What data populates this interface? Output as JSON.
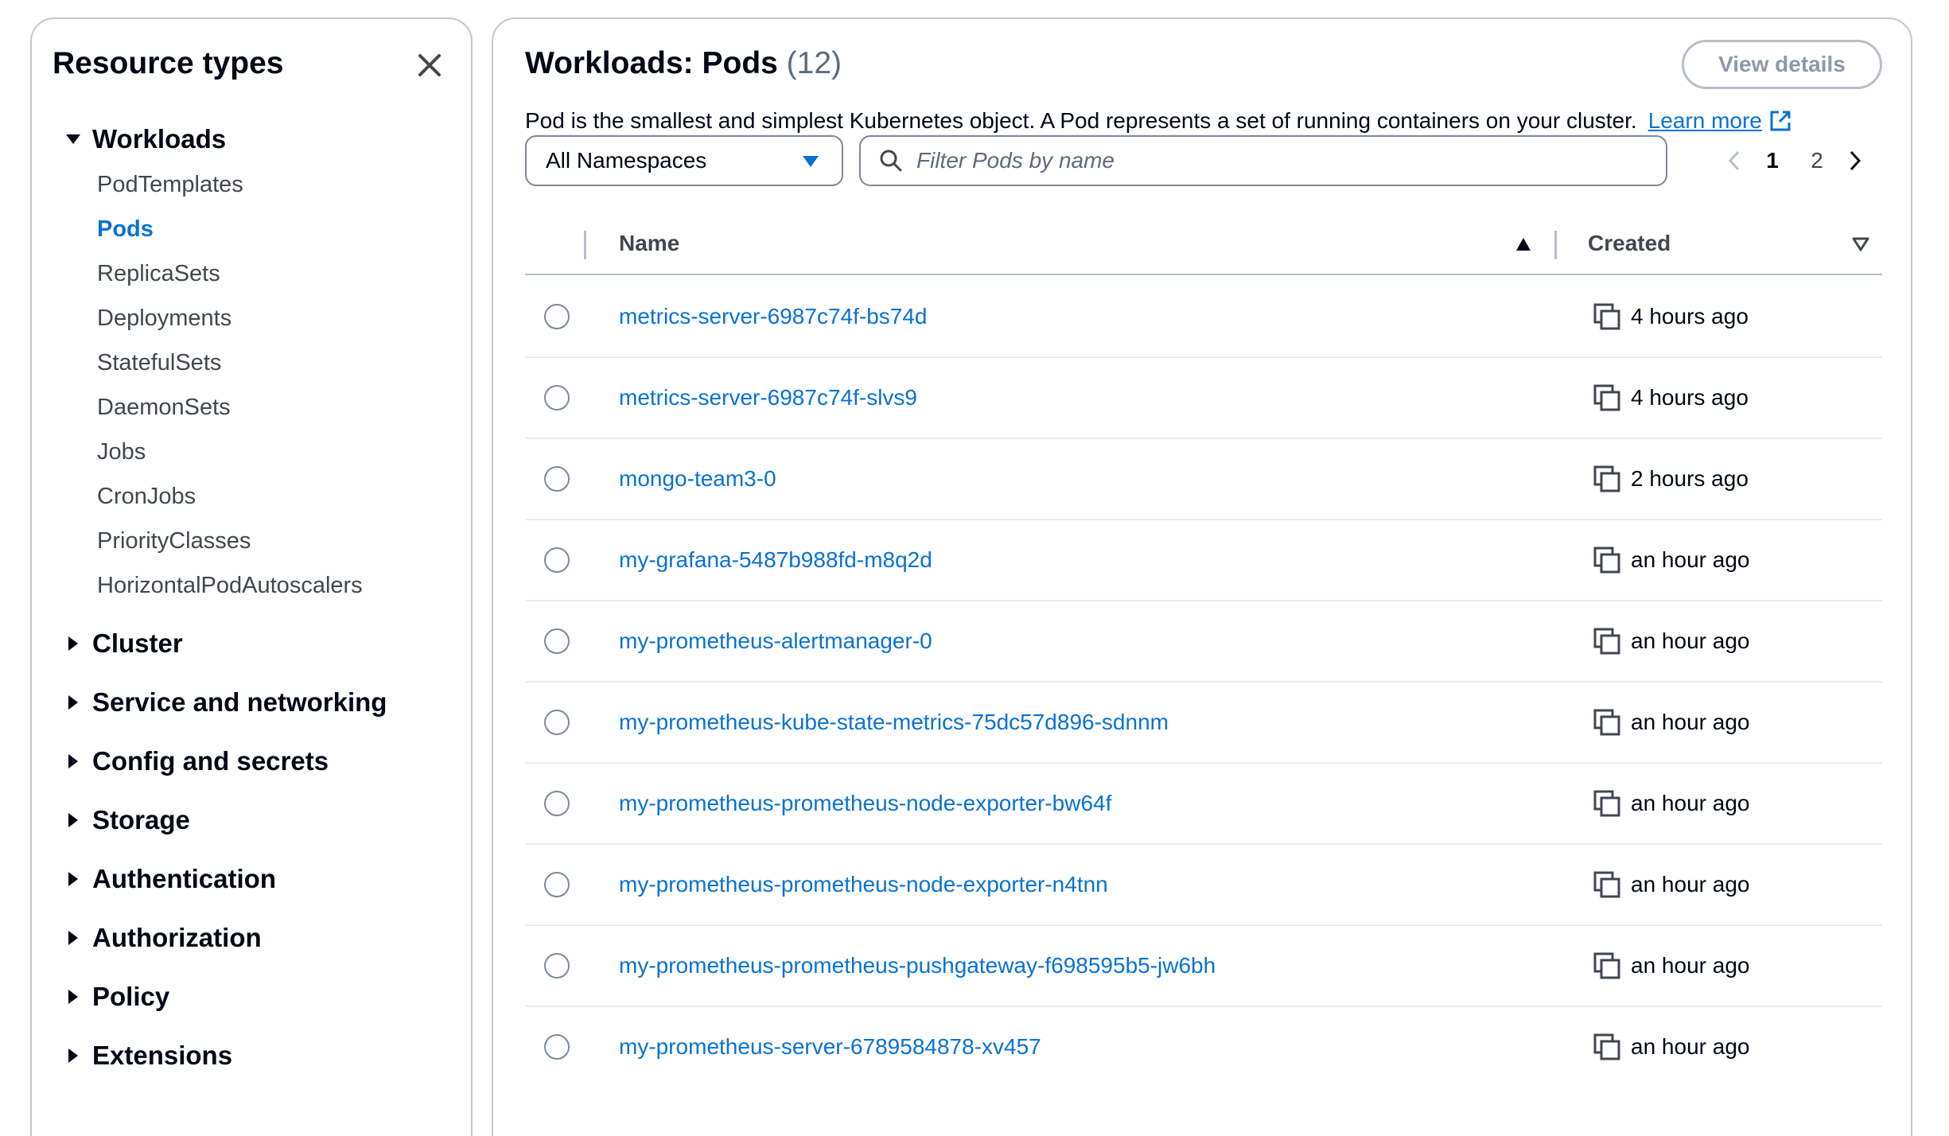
{
  "sidebar": {
    "title": "Resource types",
    "groups": [
      {
        "label": "Workloads",
        "expanded": true
      },
      {
        "label": "Cluster",
        "expanded": false
      },
      {
        "label": "Service and networking",
        "expanded": false
      },
      {
        "label": "Config and secrets",
        "expanded": false
      },
      {
        "label": "Storage",
        "expanded": false
      },
      {
        "label": "Authentication",
        "expanded": false
      },
      {
        "label": "Authorization",
        "expanded": false
      },
      {
        "label": "Policy",
        "expanded": false
      },
      {
        "label": "Extensions",
        "expanded": false
      }
    ],
    "workload_items": [
      "PodTemplates",
      "Pods",
      "ReplicaSets",
      "Deployments",
      "StatefulSets",
      "DaemonSets",
      "Jobs",
      "CronJobs",
      "PriorityClasses",
      "HorizontalPodAutoscalers"
    ],
    "active_item": "Pods"
  },
  "main": {
    "title": "Workloads: Pods",
    "count": "(12)",
    "view_details_label": "View details",
    "description": "Pod is the smallest and simplest Kubernetes object. A Pod represents a set of running containers on your cluster.",
    "learn_more": "Learn more",
    "namespace_select": "All Namespaces",
    "filter_placeholder": "Filter Pods by name",
    "filter_value": "",
    "pagination": {
      "pages": [
        "1",
        "2"
      ],
      "current": "1"
    },
    "columns": {
      "name": "Name",
      "created": "Created"
    },
    "rows": [
      {
        "name": "metrics-server-6987c74f-bs74d",
        "created": "4 hours ago"
      },
      {
        "name": "metrics-server-6987c74f-slvs9",
        "created": "4 hours ago"
      },
      {
        "name": "mongo-team3-0",
        "created": "2 hours ago"
      },
      {
        "name": "my-grafana-5487b988fd-m8q2d",
        "created": "an hour ago"
      },
      {
        "name": "my-prometheus-alertmanager-0",
        "created": "an hour ago"
      },
      {
        "name": "my-prometheus-kube-state-metrics-75dc57d896-sdnnm",
        "created": "an hour ago"
      },
      {
        "name": "my-prometheus-prometheus-node-exporter-bw64f",
        "created": "an hour ago"
      },
      {
        "name": "my-prometheus-prometheus-node-exporter-n4tnn",
        "created": "an hour ago"
      },
      {
        "name": "my-prometheus-prometheus-pushgateway-f698595b5-jw6bh",
        "created": "an hour ago"
      },
      {
        "name": "my-prometheus-server-6789584878-xv457",
        "created": "an hour ago"
      }
    ]
  },
  "colors": {
    "link": "#0972d3",
    "text": "#000716",
    "muted": "#424650",
    "border": "#c6c6cd"
  },
  "icons": [
    "close-icon",
    "caret-down-icon",
    "caret-right-icon",
    "external-link-icon",
    "dropdown-triangle-icon",
    "search-icon",
    "chevron-left-icon",
    "chevron-right-icon",
    "sort-ascending-icon",
    "sort-descending-icon",
    "copy-icon"
  ]
}
